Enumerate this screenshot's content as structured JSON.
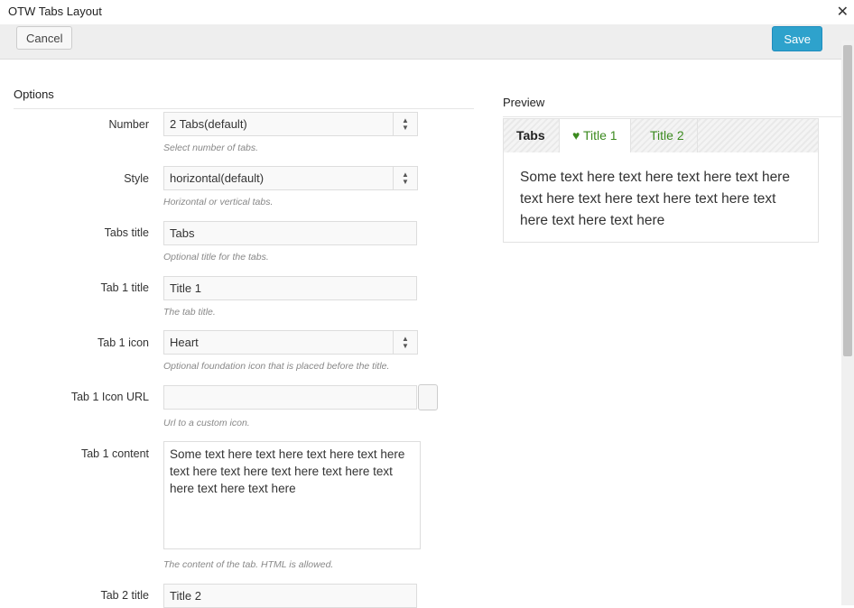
{
  "window": {
    "title": "OTW Tabs Layout"
  },
  "toolbar": {
    "cancel_label": "Cancel",
    "save_label": "Save"
  },
  "options": {
    "heading": "Options",
    "number": {
      "label": "Number",
      "value": "2 Tabs(default)",
      "hint": "Select number of tabs."
    },
    "style": {
      "label": "Style",
      "value": "horizontal(default)",
      "hint": "Horizontal or vertical tabs."
    },
    "tabs_title": {
      "label": "Tabs title",
      "value": "Tabs",
      "hint": "Optional title for the tabs."
    },
    "tab1_title": {
      "label": "Tab 1 title",
      "value": "Title 1",
      "hint": "The tab title."
    },
    "tab1_icon": {
      "label": "Tab 1 icon",
      "value": "Heart",
      "hint": "Optional foundation icon that is placed before the title."
    },
    "tab1_icon_url": {
      "label": "Tab 1 Icon URL",
      "value": "",
      "hint": "Url to a custom icon."
    },
    "tab1_content": {
      "label": "Tab 1 content",
      "value": "Some text here text here text here text here text here text here text here text here text here text here text here",
      "hint": "The content of the tab. HTML is allowed."
    },
    "tab2_title": {
      "label": "Tab 2 title",
      "value": "Title 2"
    }
  },
  "preview": {
    "heading": "Preview",
    "tabs_title": "Tabs",
    "tab1_label": "Title 1",
    "tab1_icon": "heart-icon",
    "tab2_label": "Title 2",
    "content": "Some text here text here text here text here text here text here text here text here text here text here text here",
    "accent_color": "#3b8a1f"
  },
  "colors": {
    "save_button": "#2ea2cc"
  }
}
